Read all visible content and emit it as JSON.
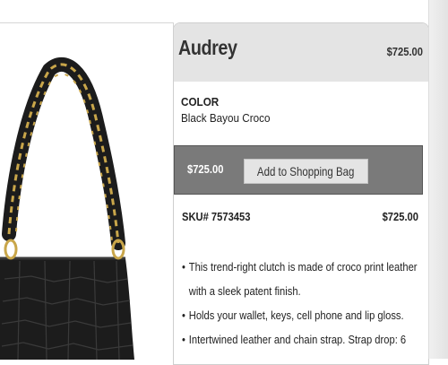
{
  "product": {
    "name": "Audrey",
    "price": "$725.00",
    "color_label": "COLOR",
    "color_value": "Black Bayou Croco"
  },
  "buy": {
    "price": "$725.00",
    "add_button_label": "Add to Shopping Bag"
  },
  "sku": {
    "label": "SKU# 7573453",
    "price": "$725.00"
  },
  "description": [
    {
      "text": "This trend-right clutch is made of croco print leather"
    },
    {
      "text": "with a sleek patent finish."
    },
    {
      "text": "Holds your wallet, keys, cell phone and lip gloss."
    },
    {
      "text": "Intertwined leather and chain strap. Strap drop: 6"
    }
  ],
  "image": {
    "icon": "handbag-photo"
  },
  "colors": {
    "header_bg": "#e4e4e4",
    "buy_bar_bg": "#7a7a7a",
    "button_bg": "#e4e4e4",
    "handbag": "#1c1c1c",
    "chain": "#c9a64a"
  }
}
